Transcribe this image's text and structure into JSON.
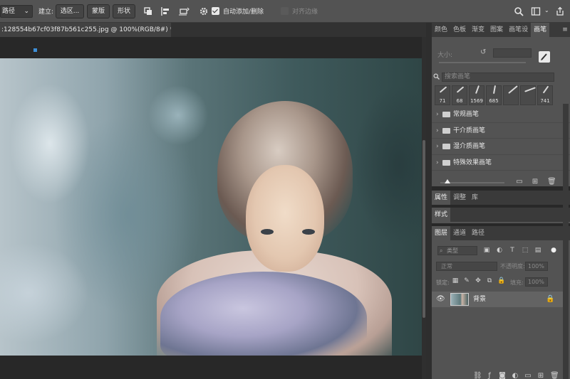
{
  "options_bar": {
    "mode_select": "路径",
    "make_label": "建立:",
    "selection_button": "选区...",
    "mask_button": "蒙版",
    "shape_button": "形状",
    "auto_add_delete_label": "自动添加/删除",
    "align_edges_label": "对齐边缘",
    "auto_add_delete_checked": true,
    "align_edges_checked": false,
    "icons": [
      "path-operations-icon",
      "path-alignment-icon",
      "path-arrangement-icon",
      "gear-icon",
      "search-icon",
      "workspace-icon",
      "share-icon"
    ]
  },
  "document": {
    "tab_title": ":128554b67cf03f87b561c255.jpg @ 100%(RGB/8#) *"
  },
  "brush_panel": {
    "tabs": [
      "颜色",
      "色板",
      "渐变",
      "图案",
      "画笔设",
      "画笔"
    ],
    "active_tab": "画笔",
    "size_label": "大小:",
    "search_placeholder": "搜索画笔",
    "tips": [
      {
        "size": "71"
      },
      {
        "size": "68"
      },
      {
        "size": "1569"
      },
      {
        "size": "685"
      },
      {
        "size": ""
      },
      {
        "size": ""
      },
      {
        "size": "741"
      }
    ],
    "folders": [
      {
        "label": "常规画笔"
      },
      {
        "label": "干介质画笔"
      },
      {
        "label": "湿介质画笔"
      },
      {
        "label": "特殊效果画笔"
      }
    ]
  },
  "properties_panel": {
    "tabs": [
      "属性",
      "调整",
      "库"
    ],
    "active_tab": "属性"
  },
  "styles_panel": {
    "tabs": [
      "样式"
    ],
    "active_tab": "样式"
  },
  "layers_panel": {
    "tabs": [
      "图层",
      "通道",
      "路径"
    ],
    "active_tab": "图层",
    "kind_select": "类型",
    "blend_mode": "正常",
    "opacity_label": "不透明度:",
    "opacity_value": "100%",
    "lock_label": "锁定:",
    "fill_label": "填充:",
    "fill_value": "100%",
    "layers": [
      {
        "name": "背景",
        "visible": true,
        "locked": true
      }
    ]
  },
  "colors": {
    "chrome": "#535353",
    "dark": "#282828",
    "accent": "#3d8fd8"
  }
}
